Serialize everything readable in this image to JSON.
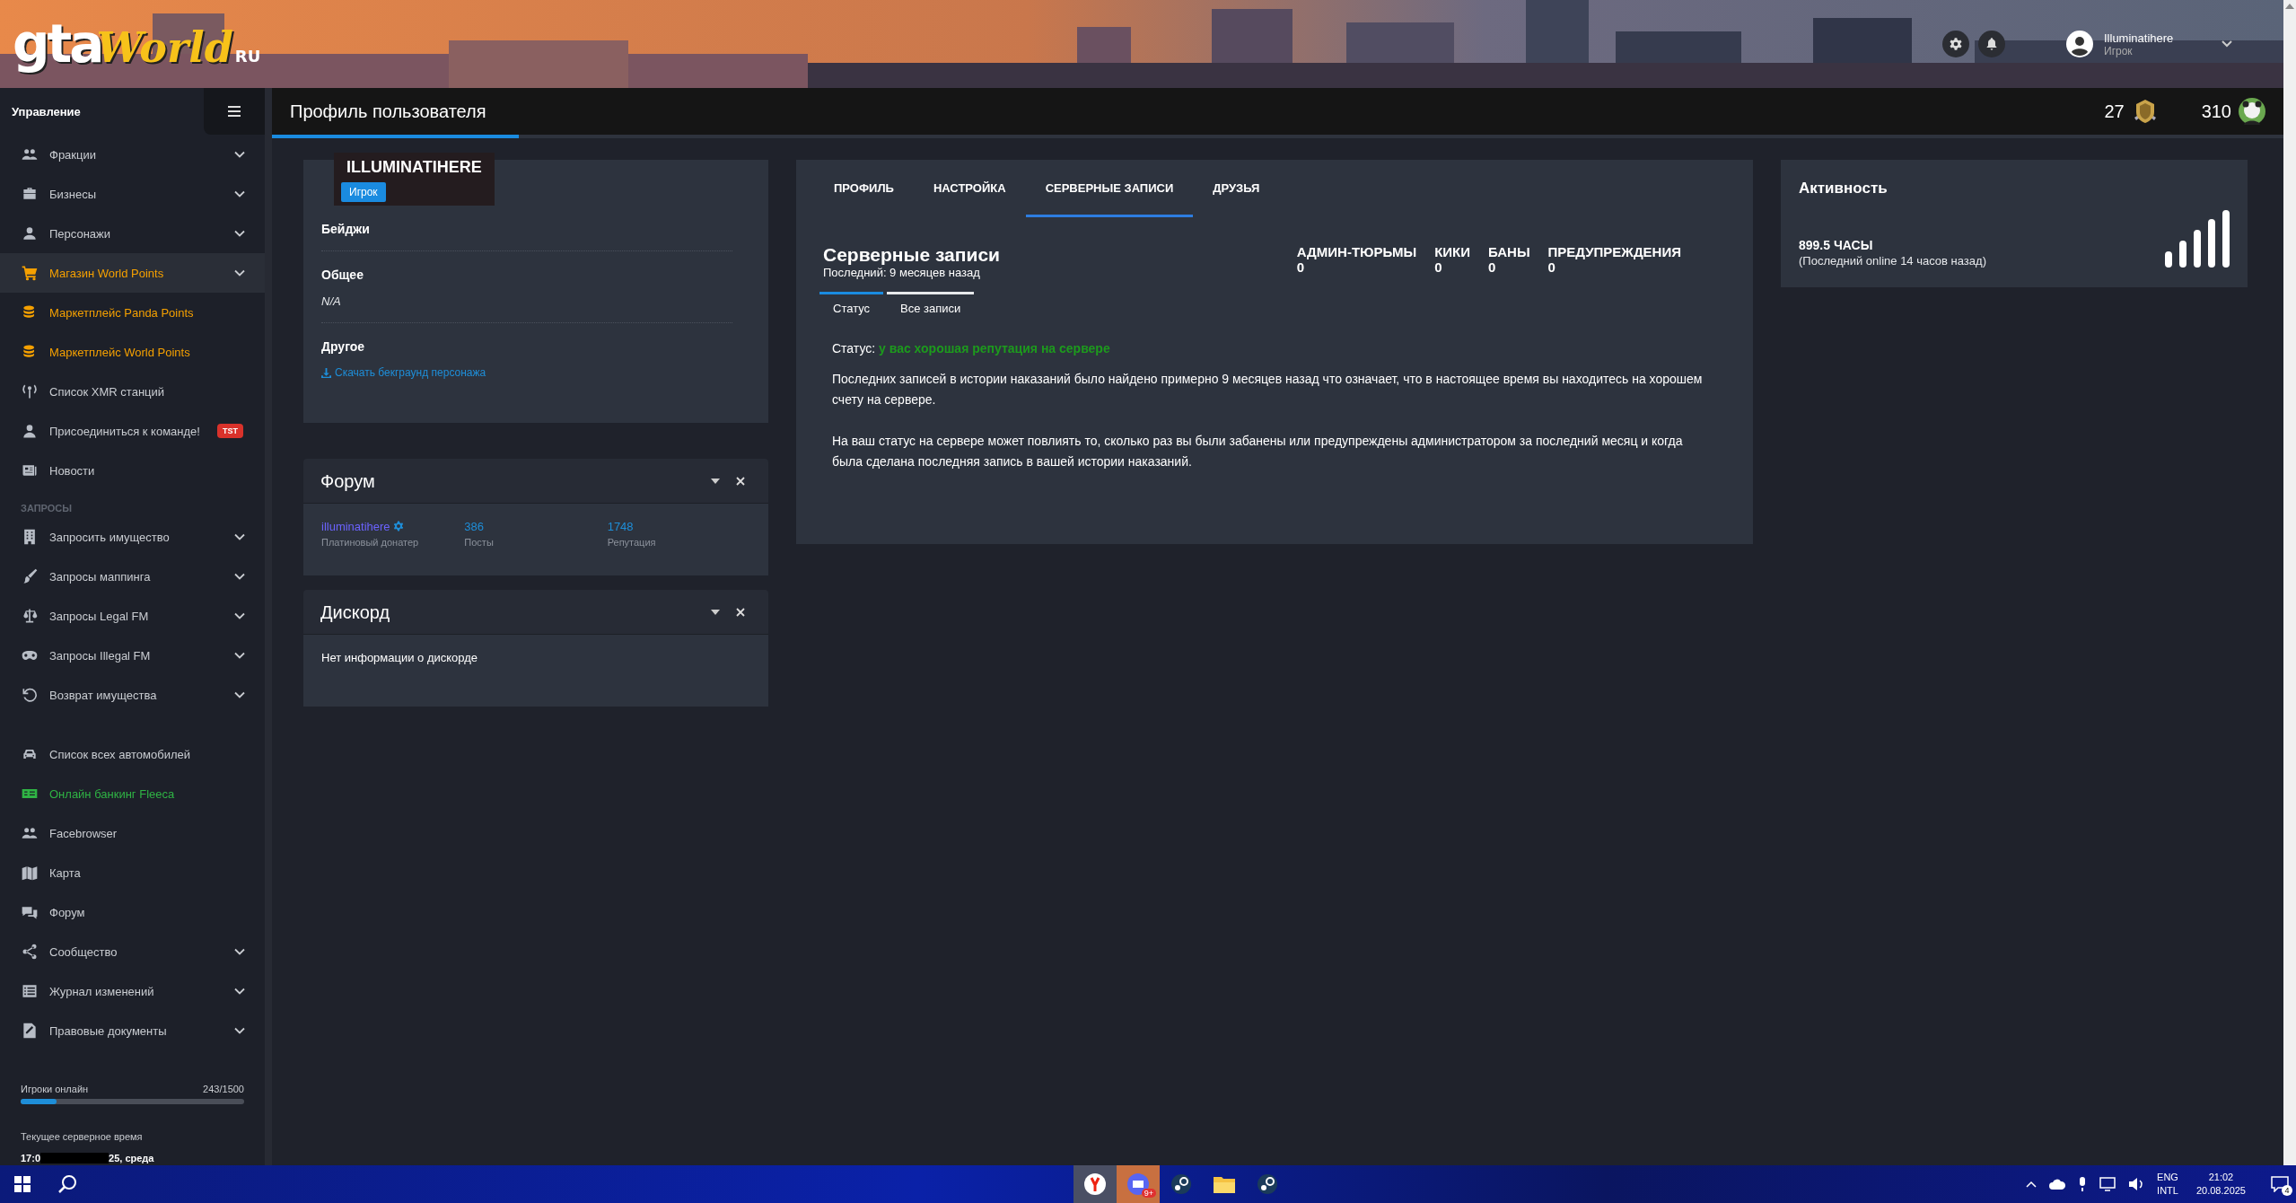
{
  "logo": {
    "parts": [
      "gta",
      "World",
      "RU"
    ]
  },
  "header": {
    "user": {
      "name": "Illuminatihere",
      "role": "Игрок"
    }
  },
  "sidebar": {
    "title": "Управление",
    "sections": [
      {
        "items": [
          {
            "label": "Фракции",
            "expandable": true,
            "selected": false,
            "color": "#c9ccd1"
          },
          {
            "label": "Бизнесы",
            "expandable": true,
            "selected": false,
            "color": "#c9ccd1"
          },
          {
            "label": "Персонажи",
            "expandable": true,
            "selected": false,
            "color": "#c9ccd1"
          },
          {
            "label": "Магазин World Points",
            "expandable": true,
            "selected": true,
            "color": "#f5a000"
          },
          {
            "label": "Маркетплейс Panda Points",
            "expandable": false,
            "selected": false,
            "color": "#f5a000"
          },
          {
            "label": "Маркетплейс World Points",
            "expandable": false,
            "selected": false,
            "color": "#f5a000"
          },
          {
            "label": "Список XMR станций",
            "expandable": false,
            "selected": false,
            "color": "#c9ccd1"
          },
          {
            "label": "Присоединиться к команде!",
            "expandable": false,
            "selected": false,
            "color": "#c9ccd1",
            "badge": "TST"
          },
          {
            "label": "Новости",
            "expandable": false,
            "selected": false,
            "color": "#c9ccd1"
          }
        ]
      },
      {
        "label": "ЗАПРОСЫ",
        "items": [
          {
            "label": "Запросить имущество",
            "expandable": true,
            "selected": false,
            "color": "#c9ccd1"
          },
          {
            "label": "Запросы маппинга",
            "expandable": true,
            "selected": false,
            "color": "#c9ccd1"
          },
          {
            "label": "Запросы Legal FM",
            "expandable": true,
            "selected": false,
            "color": "#c9ccd1"
          },
          {
            "label": "Запросы Illegal FM",
            "expandable": true,
            "selected": false,
            "color": "#c9ccd1"
          },
          {
            "label": "Возврат имущества",
            "expandable": true,
            "selected": false,
            "color": "#c9ccd1"
          }
        ]
      },
      {
        "items": [
          {
            "label": "Список всех автомобилей",
            "expandable": false,
            "selected": false,
            "color": "#c9ccd1"
          },
          {
            "label": "Онлайн банкинг Fleeca",
            "expandable": false,
            "selected": false,
            "color": "#2fb344"
          },
          {
            "label": "Facebrowser",
            "expandable": false,
            "selected": false,
            "color": "#c9ccd1"
          },
          {
            "label": "Карта",
            "expandable": false,
            "selected": false,
            "color": "#c9ccd1"
          },
          {
            "label": "Форум",
            "expandable": false,
            "selected": false,
            "color": "#c9ccd1"
          },
          {
            "label": "Сообщество",
            "expandable": true,
            "selected": false,
            "color": "#c9ccd1"
          },
          {
            "label": "Журнал изменений",
            "expandable": true,
            "selected": false,
            "color": "#c9ccd1"
          },
          {
            "label": "Правовые документы",
            "expandable": true,
            "selected": false,
            "color": "#c9ccd1"
          }
        ]
      }
    ],
    "online": {
      "label": "Игроки онлайн",
      "count": "243/1500",
      "level": 0.162
    },
    "server_time": {
      "label": "Текущее серверное время",
      "start": "17:0",
      "end": "25, среда"
    }
  },
  "topbar": {
    "tab": {
      "label": "Профиль пользователя",
      "selected": true
    },
    "stats": [
      "27",
      "310"
    ]
  },
  "profile": {
    "name": "ILLUMINATIHERE",
    "role": "Игрок",
    "sections": [
      {
        "title": "Бейджи"
      },
      {
        "title": "Общее",
        "value": "N/A"
      },
      {
        "title": "Другое",
        "link": "Скачать бекграунд персонажа"
      }
    ]
  },
  "forum": {
    "title": "Форум",
    "username": "illuminatihere",
    "rank": "Платиновый донатер",
    "stats": [
      {
        "value": "386",
        "label": "Посты"
      },
      {
        "value": "1748",
        "label": "Репутация"
      }
    ]
  },
  "discord": {
    "title": "Дискорд",
    "text": "Нет информации о дискорде"
  },
  "records": {
    "tabs": [
      {
        "label": "ПРОФИЛЬ",
        "selected": false
      },
      {
        "label": "НАСТРОЙКА",
        "selected": false
      },
      {
        "label": "СЕРВЕРНЫЕ ЗАПИСИ",
        "selected": true
      },
      {
        "label": "ДРУЗЬЯ",
        "selected": false
      }
    ],
    "title": "Серверные записи",
    "last": "Последний: 9 месяцев назад",
    "counters": [
      {
        "label": "АДМИН-ТЮРЬМЫ",
        "value": "0"
      },
      {
        "label": "КИКИ",
        "value": "0"
      },
      {
        "label": "БАНЫ",
        "value": "0"
      },
      {
        "label": "ПРЕДУПРЕЖДЕНИЯ",
        "value": "0"
      }
    ],
    "subtabs": [
      {
        "label": "Статус",
        "selected": true
      },
      {
        "label": "Все записи",
        "selected": false
      }
    ],
    "status_label": "Статус:",
    "status_value": "у вас хорошая репутация на сервере",
    "paragraphs": [
      "Последних записей в истории наказаний было найдено примерно 9 месяцев назад что означает, что в настоящее время вы находитесь на хорошем счету на сервере.",
      "На ваш статус на сервере может повлиять то, сколько раз вы были забанены или предупреждены администратором за последний месяц и когда была сделана последняя запись в вашей истории наказаний."
    ]
  },
  "activity": {
    "title": "Активность",
    "hours": "899.5 ЧАСЫ",
    "last_online": "(Последний online 14 часов назад)"
  },
  "taskbar": {
    "discord_badge": "9+",
    "language": [
      "ENG",
      "INTL"
    ],
    "time": "21:02",
    "date": "20.08.2025",
    "notifications": "4"
  }
}
